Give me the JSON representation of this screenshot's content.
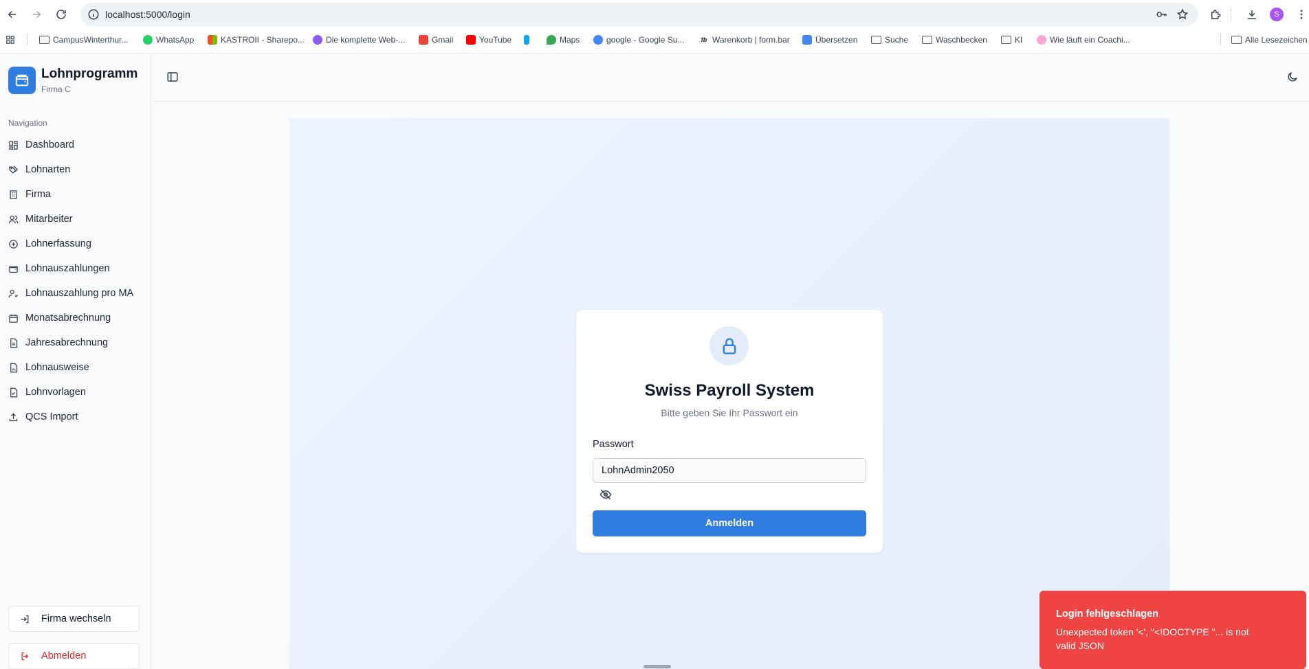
{
  "browser": {
    "url": "localhost:5000/login",
    "profile_initial": "S",
    "bookmarks": [
      {
        "label": "CampusWinterthur..."
      },
      {
        "label": "WhatsApp"
      },
      {
        "label": "KASTROII - Sharepo..."
      },
      {
        "label": "Die komplette Web-..."
      },
      {
        "label": "Gmail"
      },
      {
        "label": "YouTube"
      },
      {
        "label": ""
      },
      {
        "label": "Maps"
      },
      {
        "label": "google - Google Su..."
      },
      {
        "label": "Warenkorb | form.bar"
      },
      {
        "label": "Übersetzen"
      },
      {
        "label": "Suche"
      },
      {
        "label": "Waschbecken"
      },
      {
        "label": "KI"
      },
      {
        "label": "Wie läuft ein Coachi..."
      },
      {
        "label": "Alle Lesezeichen"
      }
    ]
  },
  "sidebar": {
    "title": "Lohnprogramm",
    "subtitle": "Firma C",
    "nav_label": "Navigation",
    "items": [
      {
        "label": "Dashboard",
        "icon": "grid-icon"
      },
      {
        "label": "Lohnarten",
        "icon": "tags-icon"
      },
      {
        "label": "Firma",
        "icon": "building-icon"
      },
      {
        "label": "Mitarbeiter",
        "icon": "users-icon"
      },
      {
        "label": "Lohnerfassung",
        "icon": "plus-circle-icon"
      },
      {
        "label": "Lohnauszahlungen",
        "icon": "wallet-icon"
      },
      {
        "label": "Lohnauszahlung pro MA",
        "icon": "user-check-icon"
      },
      {
        "label": "Monatsabrechnung",
        "icon": "calendar-icon"
      },
      {
        "label": "Jahresabrechnung",
        "icon": "file-text-icon"
      },
      {
        "label": "Lohnausweise",
        "icon": "file-chart-icon"
      },
      {
        "label": "Lohnvorlagen",
        "icon": "file-check-icon"
      },
      {
        "label": "QCS Import",
        "icon": "upload-icon"
      }
    ],
    "switch_company": "Firma wechseln",
    "logout": "Abmelden"
  },
  "login": {
    "title": "Swiss Payroll System",
    "subtitle": "Bitte geben Sie Ihr Passwort ein",
    "password_label": "Passwort",
    "password_value": "LohnAdmin2050",
    "submit": "Anmelden"
  },
  "toast": {
    "title": "Login fehlgeschlagen",
    "message": "Unexpected token '<', \"<!DOCTYPE \"... is not valid JSON"
  },
  "colors": {
    "accent": "#2f7de1",
    "error": "#ef4444",
    "logout_text": "#dc2626"
  }
}
